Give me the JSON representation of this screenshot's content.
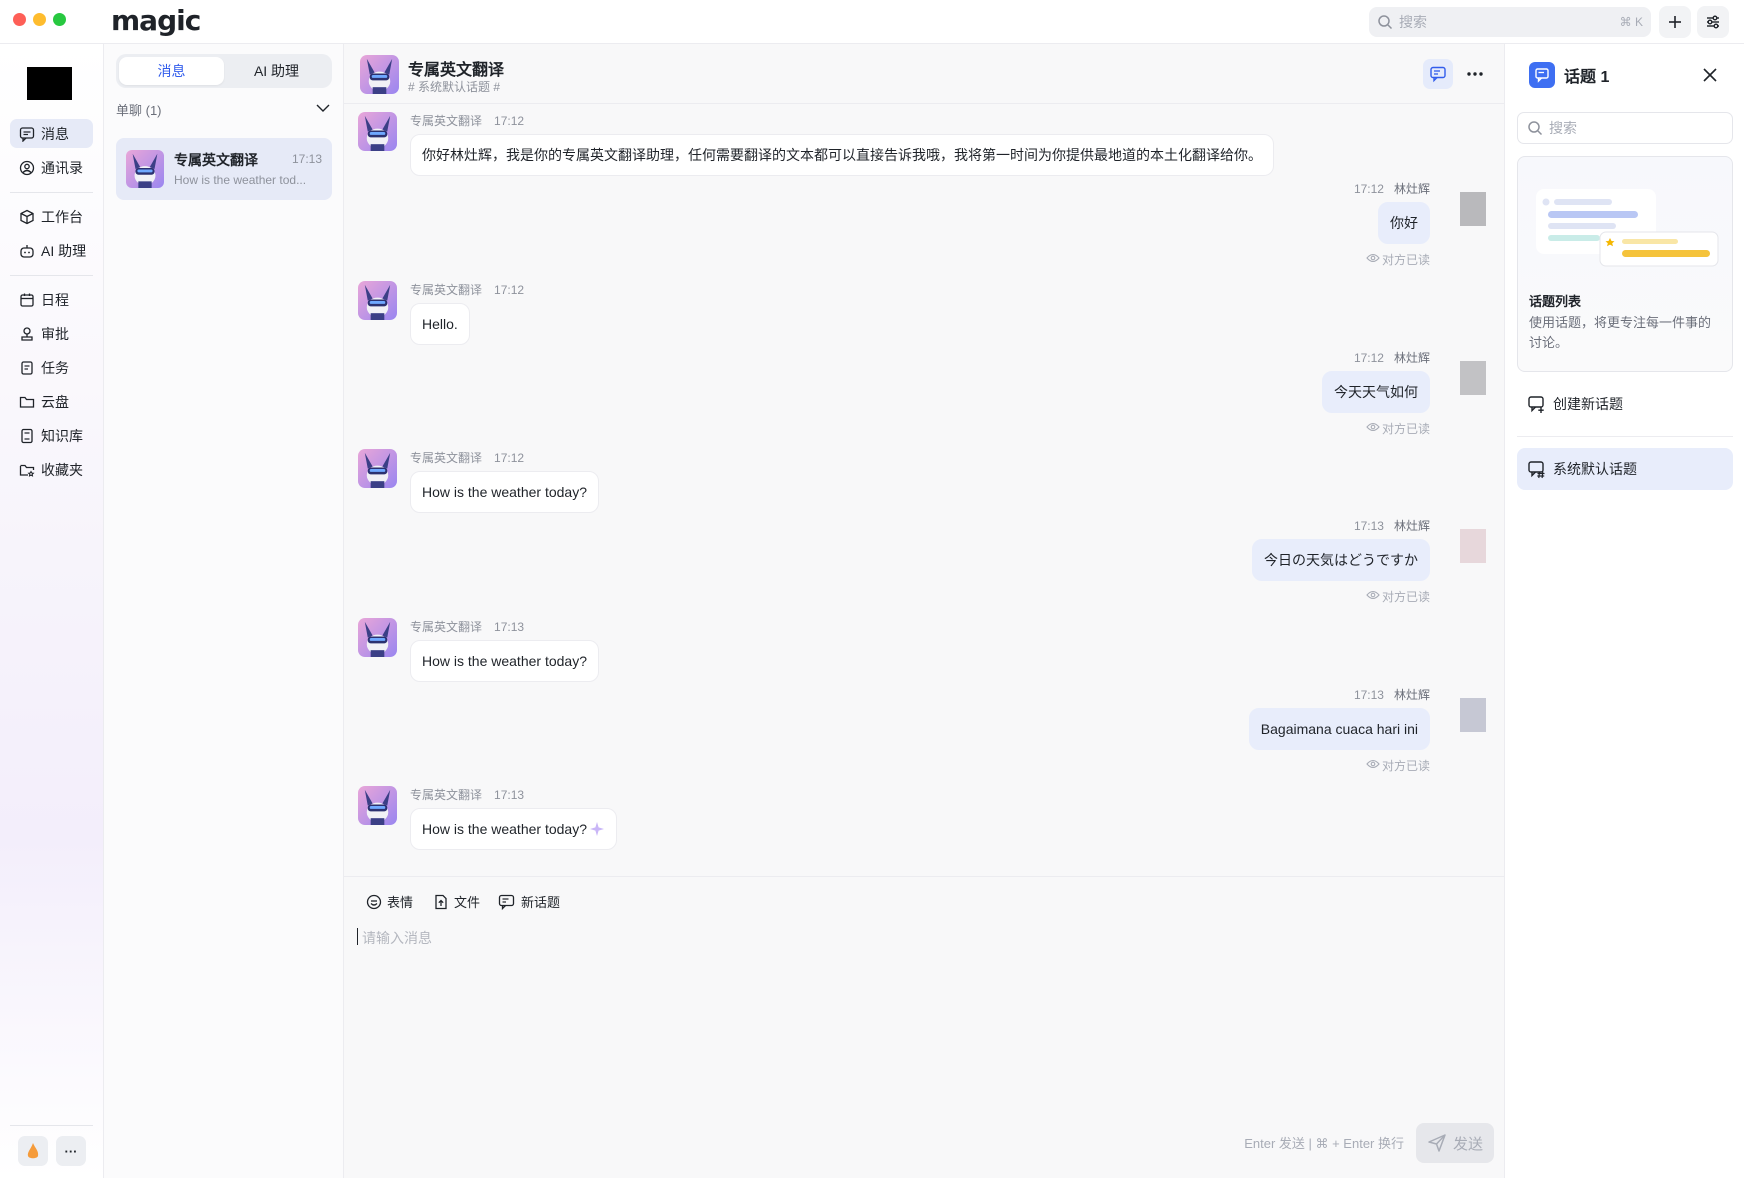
{
  "app": {
    "logo": "magic",
    "search_placeholder": "搜索",
    "search_shortcut": "⌘ K"
  },
  "nav": {
    "items": [
      {
        "label": "消息",
        "icon": "message-icon"
      },
      {
        "label": "通讯录",
        "icon": "contacts-icon"
      },
      {
        "label": "工作台",
        "icon": "workbench-icon"
      },
      {
        "label": "AI 助理",
        "icon": "robot-icon"
      },
      {
        "label": "日程",
        "icon": "calendar-icon"
      },
      {
        "label": "审批",
        "icon": "approval-icon"
      },
      {
        "label": "任务",
        "icon": "task-icon"
      },
      {
        "label": "云盘",
        "icon": "folder-icon"
      },
      {
        "label": "知识库",
        "icon": "book-icon"
      },
      {
        "label": "收藏夹",
        "icon": "favorites-icon"
      }
    ],
    "more": "···"
  },
  "convlist": {
    "tabs": [
      "消息",
      "AI 助理"
    ],
    "group_label": "单聊 (1)",
    "items": [
      {
        "name": "专属英文翻译",
        "time": "17:13",
        "preview": "How is the weather tod..."
      }
    ]
  },
  "chat": {
    "title": "专属英文翻译",
    "subtitle": "# 系统默认话题 #",
    "bot_name": "专属英文翻译",
    "user_name": "林灶辉",
    "read_status": "对方已读",
    "messages": [
      {
        "dir": "in",
        "time": "17:12",
        "text": "你好林灶辉，我是你的专属英文翻译助理，任何需要翻译的文本都可以直接告诉我哦，我将第一时间为你提供最地道的本土化翻译给你。"
      },
      {
        "dir": "out",
        "time": "17:12",
        "text": "你好",
        "avatar_color": "#b9b9bc"
      },
      {
        "dir": "in",
        "time": "17:12",
        "text": "Hello."
      },
      {
        "dir": "out",
        "time": "17:12",
        "text": "今天天气如何",
        "avatar_color": "#c2c2c5"
      },
      {
        "dir": "in",
        "time": "17:12",
        "text": "How is the weather today?"
      },
      {
        "dir": "out",
        "time": "17:13",
        "text": "今日の天気はどうですか",
        "avatar_color": "#e7d7db"
      },
      {
        "dir": "in",
        "time": "17:13",
        "text": "How is the weather today?"
      },
      {
        "dir": "out",
        "time": "17:13",
        "text": "Bagaimana cuaca hari ini",
        "avatar_color": "#c6c8d4"
      },
      {
        "dir": "in",
        "time": "17:13",
        "text": "How is the weather today?"
      }
    ],
    "composer": {
      "tools": [
        "表情",
        "文件",
        "新话题"
      ],
      "placeholder": "请输入消息",
      "hint": "Enter 发送 | ⌘ + Enter 换行",
      "send_label": "发送"
    }
  },
  "topics": {
    "title": "话题 1",
    "search_placeholder": "搜索",
    "card_title": "话题列表",
    "card_desc": "使用话题，将更专注每一件事的讨论。",
    "create_label": "创建新话题",
    "default_topic": "系统默认话题"
  },
  "colors": {
    "accent": "#315cec",
    "active_bg": "#e6eaf7",
    "bubble_out": "#e8edfb"
  }
}
